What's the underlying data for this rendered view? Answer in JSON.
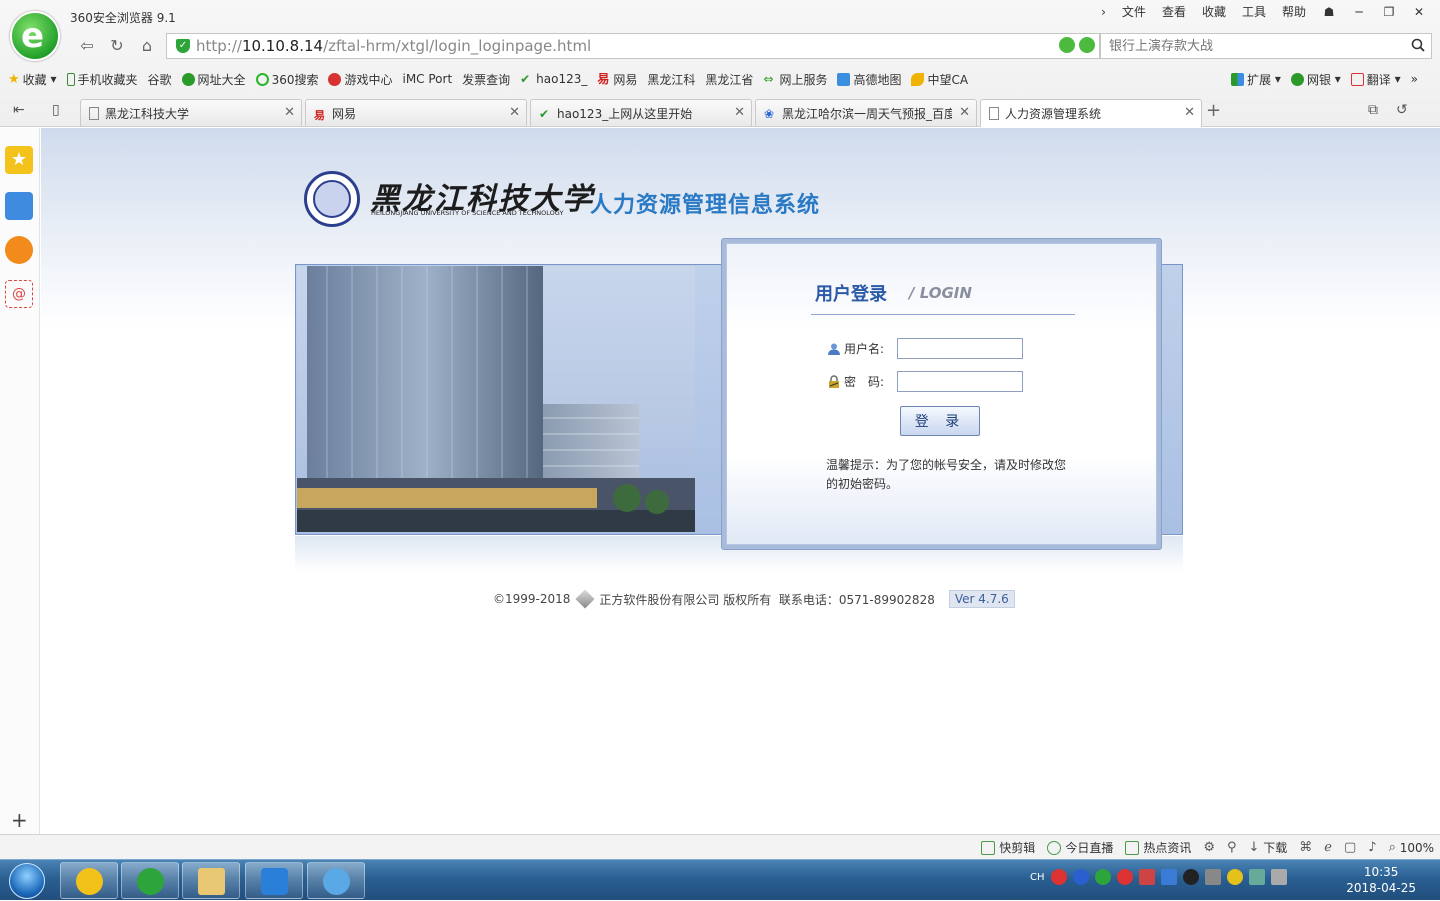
{
  "browser": {
    "title": "360安全浏览器 9.1",
    "menu": [
      "文件",
      "查看",
      "收藏",
      "工具",
      "帮助"
    ],
    "url_prefix": "http://",
    "url_host": "10.10.8.14",
    "url_path": "/zftal-hrm/xtgl/login_loginpage.html",
    "search_placeholder": "银行上演存款大战"
  },
  "bookmarks": [
    {
      "label": "收藏"
    },
    {
      "label": "手机收藏夹"
    },
    {
      "label": "谷歌"
    },
    {
      "label": "网址大全"
    },
    {
      "label": "360搜索"
    },
    {
      "label": "游戏中心"
    },
    {
      "label": "iMC Port"
    },
    {
      "label": "发票查询"
    },
    {
      "label": "hao123_"
    },
    {
      "label": "网易"
    },
    {
      "label": "黑龙江科"
    },
    {
      "label": "黑龙江省"
    },
    {
      "label": "网上服务"
    },
    {
      "label": "高德地图"
    },
    {
      "label": "中望CA"
    }
  ],
  "bookmarks_right": [
    "扩展",
    "网银",
    "翻译"
  ],
  "tabs": [
    {
      "label": "黑龙江科技大学"
    },
    {
      "label": "网易"
    },
    {
      "label": "hao123_上网从这里开始"
    },
    {
      "label": "黑龙江哈尔滨一周天气预报_百度"
    },
    {
      "label": "人力资源管理系统"
    }
  ],
  "page": {
    "university_name": "黑龙江科技大学",
    "university_en": "HEILONGJIANG UNIVERSITY OF SCIENCE AND TECHNOLOGY",
    "system_title": "人力资源管理信息系统",
    "login_title": "用户登录",
    "login_sub": "LOGIN",
    "username_label": "用户名:",
    "password_label": "密　码:",
    "login_button": "登 录",
    "hint": "温馨提示：为了您的帐号安全，请及时修改您的初始密码。",
    "footer_copy": "©1999-2018",
    "footer_company": "正方软件股份有限公司 版权所有",
    "footer_phone": "联系电话：0571-89902828",
    "footer_version": "Ver 4.7.6"
  },
  "status": {
    "items": [
      "快剪辑",
      "今日直播",
      "热点资讯",
      "下载"
    ],
    "zoom": "100%"
  },
  "taskbar": {
    "lang": "CH",
    "time": "10:35",
    "date": "2018-04-25"
  },
  "colors": {
    "brand_green": "#2da53a",
    "system_title_blue": "#2979c4",
    "login_title_blue": "#2a5aa8"
  }
}
